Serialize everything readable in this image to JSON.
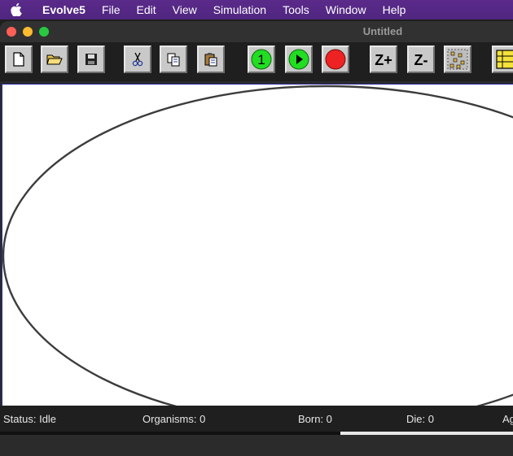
{
  "menubar": {
    "app_name": "Evolve5",
    "items": [
      "File",
      "Edit",
      "View",
      "Simulation",
      "Tools",
      "Window",
      "Help"
    ]
  },
  "window": {
    "title": "Untitled"
  },
  "toolbar": {
    "buttons": [
      {
        "name": "new-file",
        "icon": "page-icon"
      },
      {
        "name": "open-file",
        "icon": "folder-open-icon"
      },
      {
        "name": "save-file",
        "icon": "floppy-disk-icon"
      },
      {
        "name": "cut",
        "icon": "scissors-icon"
      },
      {
        "name": "copy",
        "icon": "copy-icon"
      },
      {
        "name": "paste",
        "icon": "clipboard-icon"
      },
      {
        "name": "step",
        "icon": "step-one-icon",
        "label": "1"
      },
      {
        "name": "run",
        "icon": "play-icon"
      },
      {
        "name": "stop",
        "icon": "record-stop-icon"
      },
      {
        "name": "zoom-in",
        "icon": "zoom-in-icon",
        "label": "Z+"
      },
      {
        "name": "zoom-out",
        "icon": "zoom-out-icon",
        "label": "Z-"
      },
      {
        "name": "grid",
        "icon": "grid-dots-icon"
      },
      {
        "name": "organism-view",
        "icon": "yellow-grid-icon"
      }
    ]
  },
  "statusbar": {
    "status": "Status: Idle",
    "organisms": "Organisms: 0",
    "born": "Born: 0",
    "die": "Die: 0",
    "age_partial": "Ag"
  },
  "colors": {
    "menubar": "#5b2a8a",
    "canvas": "#ffffff",
    "ellipse_stroke": "#3c3c3c",
    "step_green": "#22dd22",
    "stop_red": "#ee2222"
  }
}
